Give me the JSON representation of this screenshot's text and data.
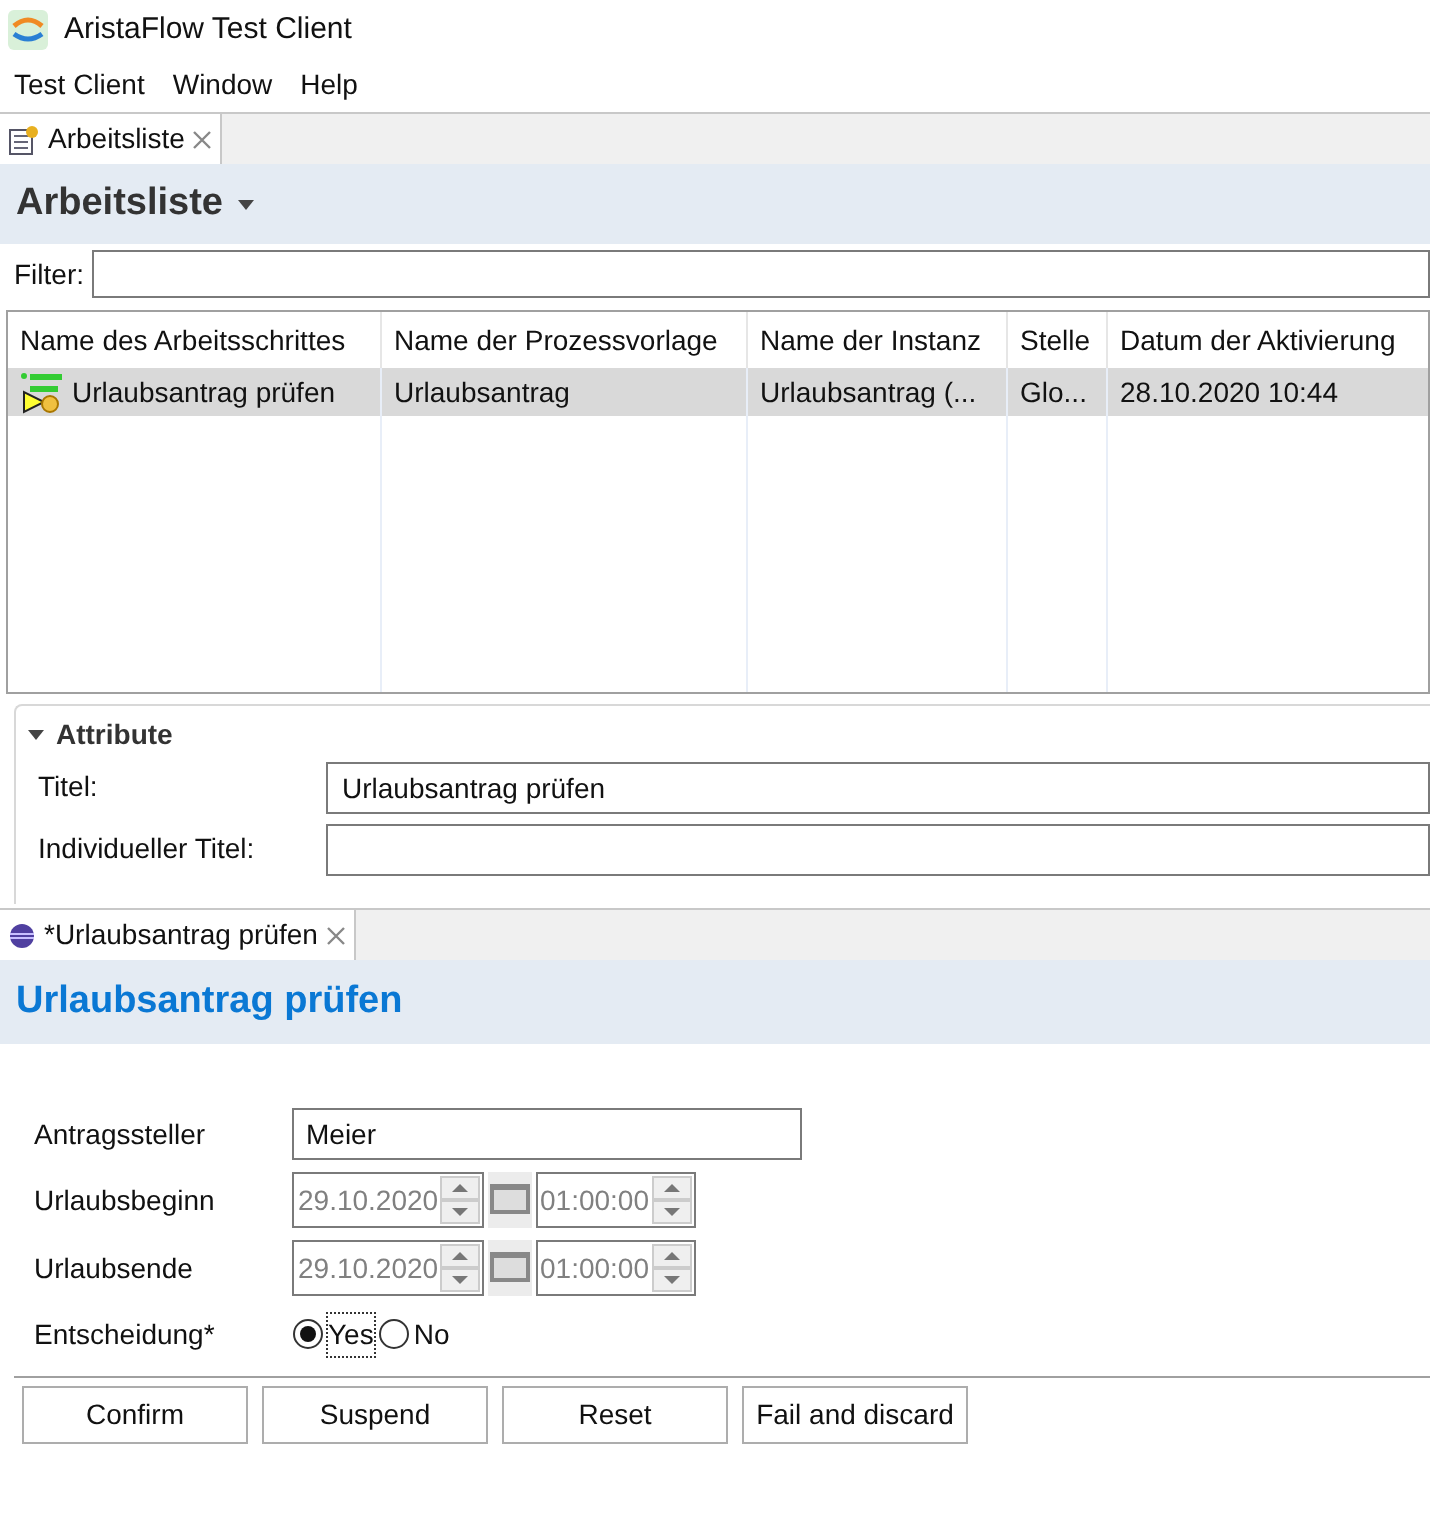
{
  "window": {
    "title": "AristaFlow Test Client"
  },
  "menu": [
    "Test Client",
    "Window",
    "Help"
  ],
  "worklist_tab": {
    "label": "Arbeitsliste",
    "selected": true
  },
  "worklist": {
    "title": "Arbeitsliste",
    "filter_label": "Filter:",
    "columns": [
      "Name des Arbeitsschrittes",
      "Name der Prozessvorlage",
      "Name der Instanz",
      "Stelle",
      "Datum der Aktivierung"
    ],
    "rows": [
      {
        "cells": [
          "Urlaubsantrag prüfen",
          "Urlaubsantrag",
          "Urlaubsantrag (...",
          "Glo...",
          "28.10.2020 10:44"
        ],
        "selected": true
      }
    ]
  },
  "attributes": {
    "title": "Attribute",
    "expanded": true,
    "fields": [
      {
        "label": "Titel:",
        "value": "Urlaubsantrag prüfen"
      },
      {
        "label": "Individueller Titel:"
      }
    ]
  },
  "form_tab": {
    "label": "*Urlaubsantrag prüfen",
    "selected": true
  },
  "form": {
    "title": "Urlaubsantrag prüfen",
    "fields": [
      {
        "kind": "text",
        "label": "Antragssteller",
        "value": "Meier"
      },
      {
        "kind": "datetime",
        "label": "Urlaubsbeginn",
        "date": "29.10.2020",
        "time": "01:00:00",
        "disabled": true
      },
      {
        "kind": "datetime",
        "label": "Urlaubsende",
        "date": "29.10.2020",
        "time": "01:00:00",
        "disabled": true
      },
      {
        "kind": "radio",
        "label": "Entscheidung*",
        "options": [
          {
            "label": "Yes",
            "selected": true
          },
          {
            "label": "No",
            "selected": false
          }
        ]
      }
    ]
  },
  "buttons": [
    "Confirm",
    "Suspend",
    "Reset",
    "Fail and discard"
  ]
}
